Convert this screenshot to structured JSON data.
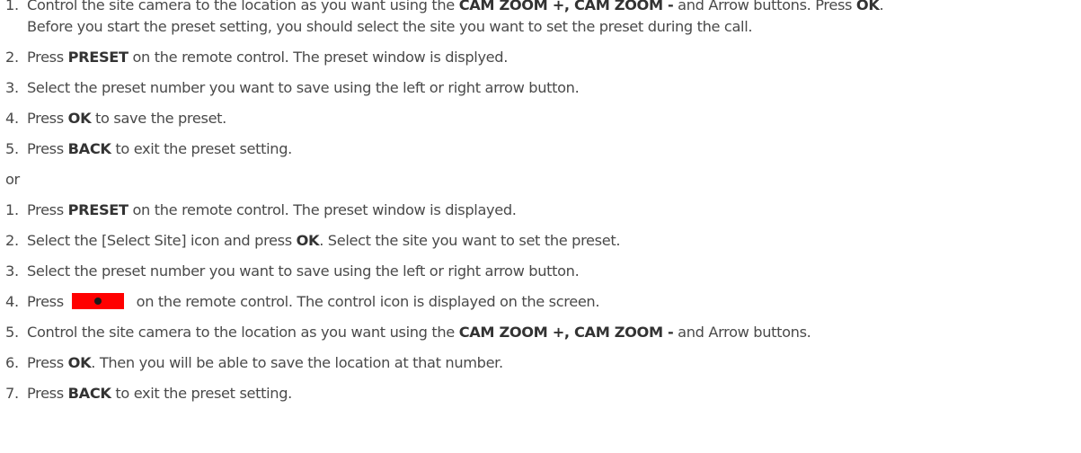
{
  "list_a": [
    {
      "num": "1.",
      "l1_a": "Control the site camera to the location as you want using the ",
      "l1_b": "CAM ZOOM +, CAM ZOOM -",
      "l1_c": " and Arrow buttons. Press ",
      "l1_d": "OK",
      "l1_e": ".",
      "l2": "Before you start the preset setting, you should select the site you want to set the preset during the call."
    },
    {
      "num": "2.",
      "a": "Press ",
      "b": "PRESET",
      "c": " on the remote control. The preset window is displyed."
    },
    {
      "num": "3.",
      "a": "Select the preset number you want to save using the left or right arrow button."
    },
    {
      "num": "4.",
      "a": "Press ",
      "b": "OK",
      "c": " to save the preset."
    },
    {
      "num": "5.",
      "a": "Press ",
      "b": "BACK",
      "c": " to exit the preset setting."
    }
  ],
  "or_text": "or",
  "list_b": [
    {
      "num": "1.",
      "a": "Press ",
      "b": "PRESET",
      "c": " on the remote control. The preset window is displayed."
    },
    {
      "num": "2.",
      "a": "Select the [Select Site] icon and press ",
      "b": "OK",
      "c": ". Select the site you want to set the preset."
    },
    {
      "num": "3.",
      "a": "Select the preset number you want to save using the left or right arrow button."
    },
    {
      "num": "4.",
      "a": "Press ",
      "c": "on the remote control. The control icon is displayed on the screen.",
      "button_color": "#ff0000"
    },
    {
      "num": "5.",
      "a": "Control the site camera to the location as you want using the ",
      "b": "CAM ZOOM +, CAM ZOOM -",
      "c": " and Arrow buttons."
    },
    {
      "num": "6.",
      "a": "Press ",
      "b": "OK",
      "c": ". Then you will be able to save the location at that number."
    },
    {
      "num": "7.",
      "a": "Press ",
      "b": "BACK",
      "c": " to exit the preset setting."
    }
  ]
}
